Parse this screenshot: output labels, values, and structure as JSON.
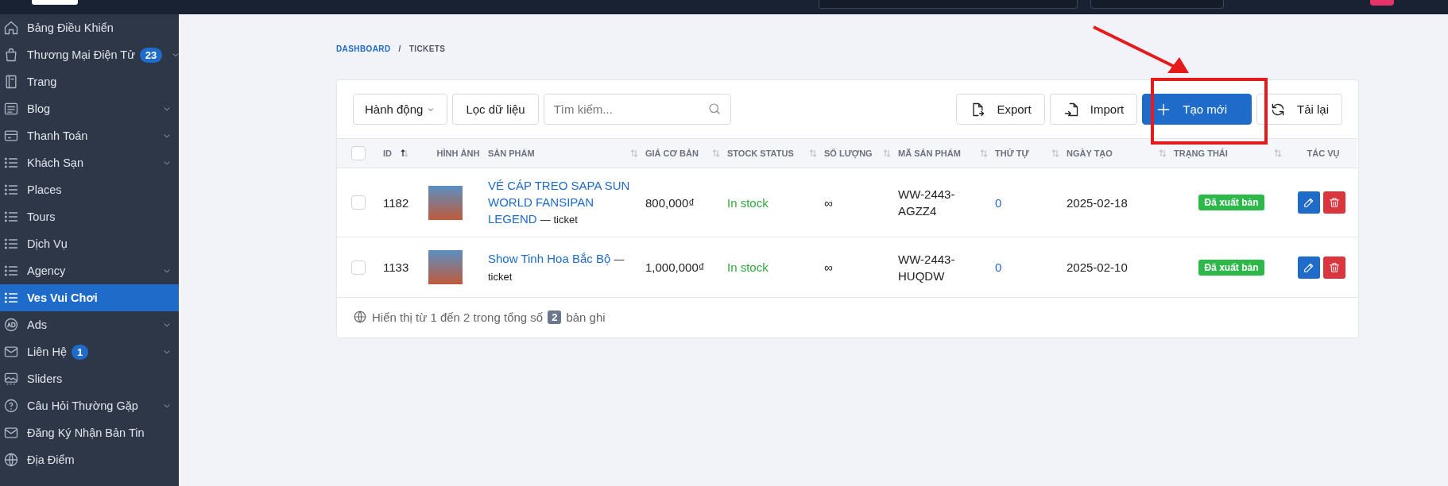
{
  "sidebar": {
    "items": [
      {
        "label": "Bảng Điều Khiển",
        "kind": "home",
        "has_submenu": false,
        "selected": false
      },
      {
        "label": "Thương Mại Điện Tử",
        "kind": "bag",
        "badge": "23",
        "has_submenu": true,
        "selected": false
      },
      {
        "label": "Trang",
        "kind": "book",
        "has_submenu": false,
        "selected": false
      },
      {
        "label": "Blog",
        "kind": "doc",
        "has_submenu": true,
        "selected": false
      },
      {
        "label": "Thanh Toán",
        "kind": "card",
        "has_submenu": true,
        "selected": false
      },
      {
        "label": "Khách Sạn",
        "kind": "list",
        "has_submenu": true,
        "selected": false
      },
      {
        "label": "Places",
        "kind": "list",
        "has_submenu": false,
        "selected": false
      },
      {
        "label": "Tours",
        "kind": "list",
        "has_submenu": false,
        "selected": false
      },
      {
        "label": "Dịch Vụ",
        "kind": "list",
        "has_submenu": false,
        "selected": false
      },
      {
        "label": "Agency",
        "kind": "list",
        "has_submenu": true,
        "selected": false
      },
      {
        "label": "Ves Vui Chơi",
        "kind": "list",
        "has_submenu": false,
        "selected": true
      },
      {
        "label": "Ads",
        "kind": "ad",
        "has_submenu": true,
        "selected": false
      },
      {
        "label": "Liên Hệ",
        "kind": "mail",
        "badge": "1",
        "has_submenu": true,
        "selected": false
      },
      {
        "label": "Sliders",
        "kind": "image",
        "has_submenu": false,
        "selected": false
      },
      {
        "label": "Câu Hỏi Thường Gặp",
        "kind": "help",
        "has_submenu": true,
        "selected": false
      },
      {
        "label": "Đăng Ký Nhận Bản Tin",
        "kind": "mail",
        "has_submenu": false,
        "selected": false
      },
      {
        "label": "Địa Điểm",
        "kind": "globe",
        "has_submenu": false,
        "selected": false
      }
    ]
  },
  "breadcrumb": {
    "items": [
      "DASHBOARD",
      "TICKETS"
    ],
    "separator": "/"
  },
  "toolbar": {
    "actions_label": "Hành động",
    "filter_label": "Lọc dữ liệu",
    "search": {
      "placeholder": "Tìm kiếm..."
    },
    "buttons": [
      {
        "label": "Export",
        "kind": "export"
      },
      {
        "label": "Import",
        "kind": "import"
      },
      {
        "label": "Tạo mới",
        "kind": "create"
      },
      {
        "label": "Tải lại",
        "kind": "reload"
      }
    ]
  },
  "table": {
    "select_all_checked": false,
    "columns": [
      {
        "label": "ID",
        "kind": "sorted_ascending"
      },
      {
        "label": "HÌNH ẢNH",
        "kind": "plain"
      },
      {
        "label": "SẢN PHẨM",
        "kind": "sortable"
      },
      {
        "label": "GIÁ CƠ BẢN",
        "kind": "sortable"
      },
      {
        "label": "STOCK STATUS",
        "kind": "sortable"
      },
      {
        "label": "SỐ LƯỢNG",
        "kind": "sortable"
      },
      {
        "label": "MÃ SẢN PHẨM",
        "kind": "sortable"
      },
      {
        "label": "THỨ TỰ",
        "kind": "sortable"
      },
      {
        "label": "NGÀY TẠO",
        "kind": "sortable"
      },
      {
        "label": "TRẠNG THÁI",
        "kind": "sortable"
      },
      {
        "label": "TÁC VỤ",
        "kind": "plain"
      }
    ],
    "rows": [
      {
        "checked": false,
        "id": "1182",
        "product": "VÉ CÁP TREO SAPA SUN WORLD FANSIPAN LEGEND",
        "type": "— ticket",
        "price": "800,000₫",
        "stock": "In stock",
        "quantity": "∞",
        "sku": "WW-2443-AGZZ4",
        "order": "0",
        "created": "2025-02-18",
        "status": "Đã xuất bản"
      },
      {
        "checked": false,
        "id": "1133",
        "product": "Show Tinh Hoa Bắc Bộ",
        "type": "— ticket",
        "price": "1,000,000₫",
        "stock": "In stock",
        "quantity": "∞",
        "sku": "WW-2443-HUQDW",
        "order": "0",
        "created": "2025-02-10",
        "status": "Đã xuất bản"
      }
    ]
  },
  "footer": {
    "text_before": "Hiển thị từ 1 đến 2 trong tổng số",
    "count": "2",
    "text_after": "bản ghi"
  }
}
